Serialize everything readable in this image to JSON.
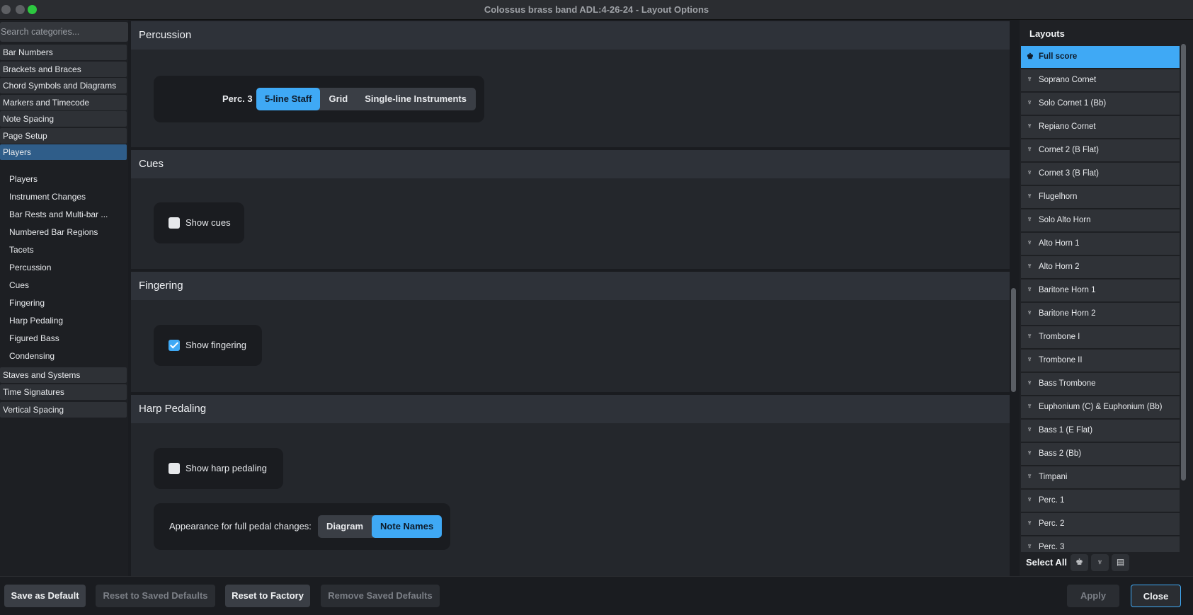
{
  "window": {
    "title": "Colossus brass band ADL:4-26-24 - Layout Options"
  },
  "sidebar": {
    "search_placeholder": "Search categories...",
    "categories": [
      "Bar Numbers",
      "Brackets and Braces",
      "Chord Symbols and Diagrams",
      "Markers and Timecode",
      "Note Spacing",
      "Page Setup",
      "Players"
    ],
    "active_category": "Players",
    "subitems": [
      "Players",
      "Instrument Changes",
      "Bar Rests and Multi-bar ...",
      "Numbered Bar Regions",
      "Tacets",
      "Percussion",
      "Cues",
      "Fingering",
      "Harp Pedaling",
      "Figured Bass",
      "Condensing"
    ],
    "categories_after": [
      "Staves and Systems",
      "Time Signatures",
      "Vertical Spacing"
    ]
  },
  "sections": {
    "percussion": {
      "title": "Percussion",
      "row_label": "Perc. 3",
      "options": [
        "5-line Staff",
        "Grid",
        "Single-line Instruments"
      ],
      "selected": "5-line Staff"
    },
    "cues": {
      "title": "Cues",
      "checkbox_label": "Show cues",
      "checked": false
    },
    "fingering": {
      "title": "Fingering",
      "checkbox_label": "Show fingering",
      "checked": true
    },
    "harp": {
      "title": "Harp Pedaling",
      "checkbox_label": "Show harp pedaling",
      "checked": false,
      "appearance_label": "Appearance for full pedal changes:",
      "options": [
        "Diagram",
        "Note Names"
      ],
      "selected": "Note Names"
    }
  },
  "layouts": {
    "title": "Layouts",
    "items": [
      "Full score",
      "Soprano Cornet",
      "Solo Cornet 1 (Bb)",
      "Repiano Cornet",
      "Cornet 2 (B Flat)",
      "Cornet 3 (B Flat)",
      "Flugelhorn",
      "Solo Alto Horn",
      "Alto Horn 1",
      "Alto Horn 2",
      "Baritone Horn 1",
      "Baritone Horn 2",
      "Trombone I",
      "Trombone II",
      "Bass Trombone",
      "Euphonium (C) & Euphonium (Bb)",
      "Bass 1 (E Flat)",
      "Bass 2 (Bb)",
      "Timpani",
      "Perc. 1",
      "Perc. 2",
      "Perc. 3"
    ],
    "selected": "Full score",
    "select_all_label": "Select All",
    "icons": [
      "full-score-icon",
      "part-icon",
      "custom-score-icon"
    ]
  },
  "footer": {
    "save_default": "Save as Default",
    "reset_saved": "Reset to Saved Defaults",
    "reset_factory": "Reset to Factory",
    "remove_saved": "Remove Saved Defaults",
    "apply": "Apply",
    "close": "Close"
  },
  "colors": {
    "accent": "#3fa9f5",
    "active_category": "#2f5d89"
  }
}
